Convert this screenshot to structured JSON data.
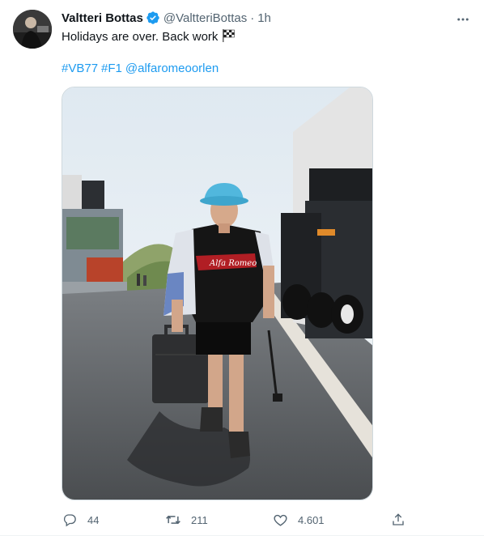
{
  "tweet": {
    "author_name": "Valtteri Bottas",
    "handle": "@ValtteriBottas",
    "separator": "·",
    "time": "1h",
    "text": "Holidays are over. Back work",
    "flag_emoji": "chequered-flag-icon",
    "hashtags": [
      "#VB77",
      "#F1"
    ],
    "mention": "@alfaromeoorlen",
    "verified": true
  },
  "media": {
    "description_icons": [
      "photo"
    ],
    "team_text": "Alfa Romeo"
  },
  "actions": {
    "replies": "44",
    "retweets": "211",
    "likes": "4.601"
  },
  "colors": {
    "accent": "#1d9bf0",
    "text": "#0f1419",
    "secondary": "#536471"
  }
}
